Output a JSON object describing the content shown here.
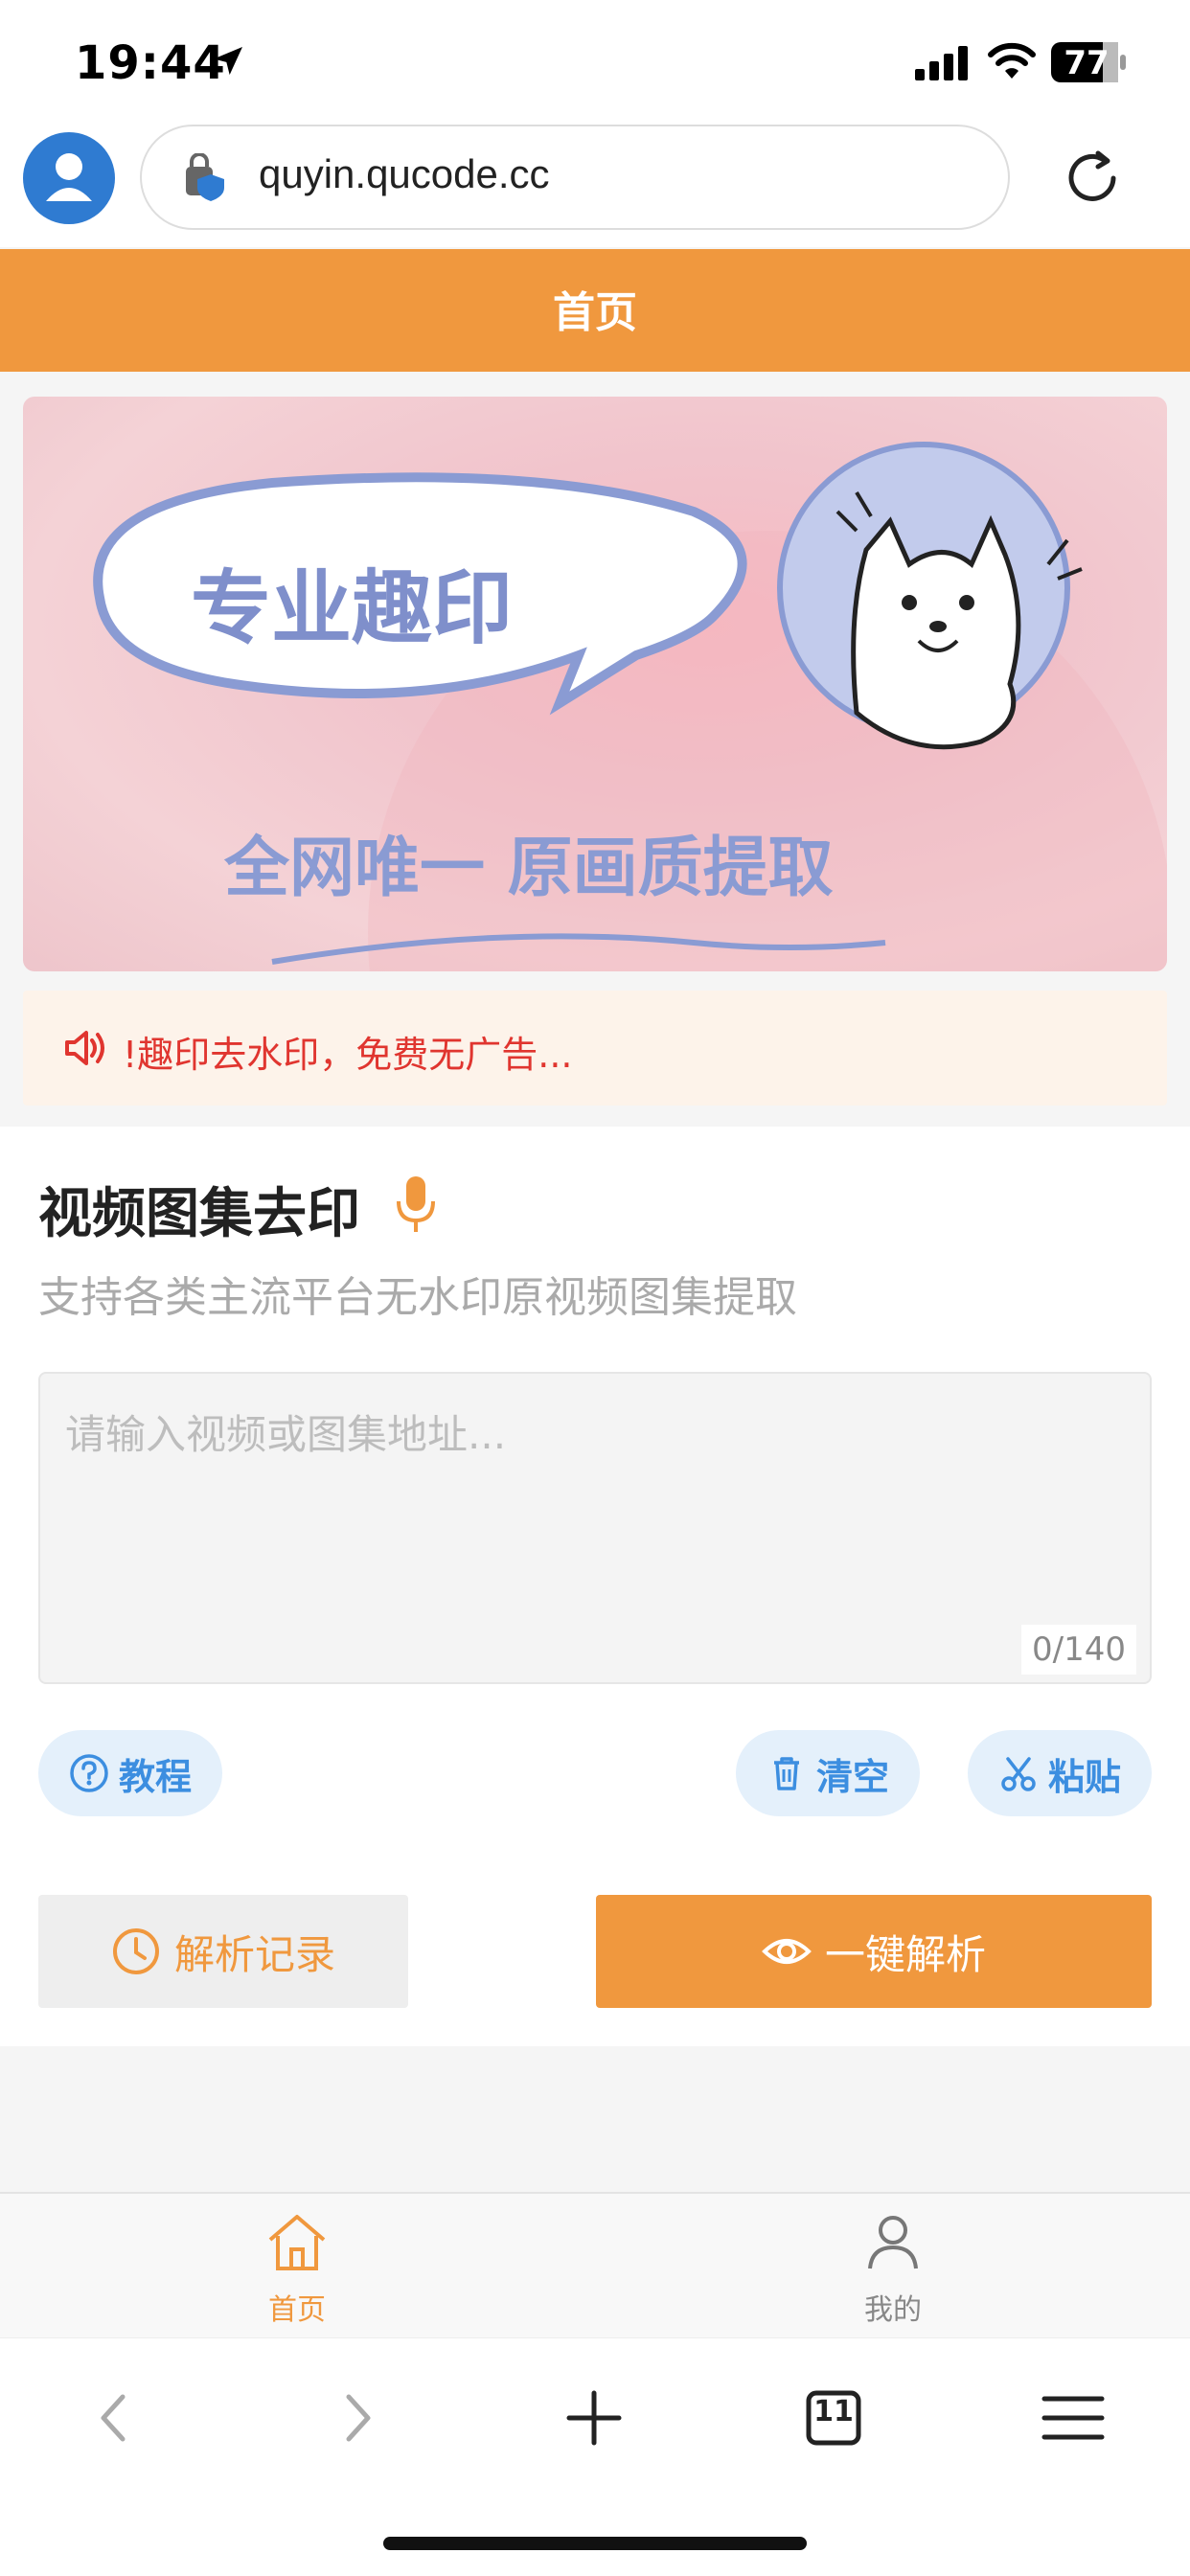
{
  "status_bar": {
    "time": "19:44",
    "battery": "77"
  },
  "browser": {
    "url": "quyin.qucode.cc",
    "tab_count": "11"
  },
  "header": {
    "title": "首页"
  },
  "banner": {
    "headline": "专业趣印",
    "tagline": "全网唯一 原画质提取"
  },
  "notice": {
    "text": "!趣印去水印，免费无广告..."
  },
  "card": {
    "title": "视频图集去印",
    "subtitle": "支持各类主流平台无水印原视频图集提取",
    "input_placeholder": "请输入视频或图集地址...",
    "char_count": "0/140",
    "tutorial_label": "教程",
    "clear_label": "清空",
    "paste_label": "粘贴",
    "history_label": "解析记录",
    "parse_label": "一键解析"
  },
  "tabs": [
    {
      "label": "首页",
      "icon": "home-icon",
      "active": true
    },
    {
      "label": "我的",
      "icon": "user-icon",
      "active": false
    }
  ],
  "colors": {
    "accent": "#f0983e",
    "link_blue": "#3c8ee0",
    "notice_red": "#e0352f"
  }
}
